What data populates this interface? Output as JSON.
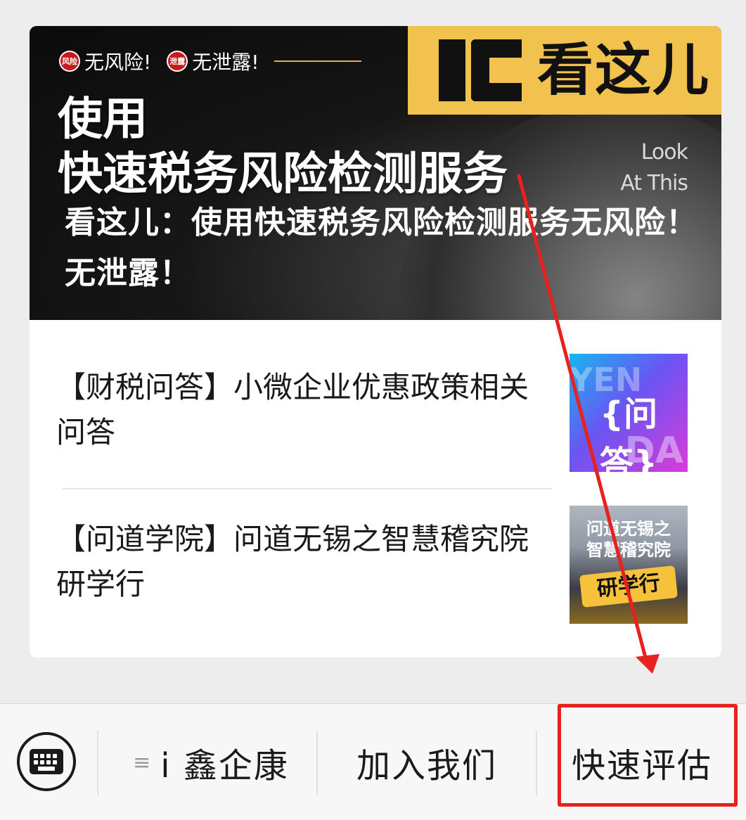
{
  "banner": {
    "tag_seal_1": "风险",
    "tag_text_1": "无风险!",
    "tag_seal_2": "泄露",
    "tag_text_2": "无泄露!",
    "logo_text": "看这儿",
    "look_line_1": "Look",
    "look_line_2": "At This",
    "headline_line_1": "使用",
    "headline_line_2": "快速税务风险检测服务",
    "subtitle": "看这儿：使用快速税务风险检测服务无风险！无泄露！"
  },
  "articles": [
    {
      "title": "【财税问答】小微企业优惠政策相关问答",
      "thumb_ghost_1": "YEN",
      "thumb_main": "{问答}",
      "thumb_ghost_2": "DA"
    },
    {
      "title": "【问道学院】问道无锡之智慧稽究院研学行",
      "thumb_line_1": "问道无锡之",
      "thumb_line_2": "智慧稽究院",
      "thumb_pill": "研学行"
    }
  ],
  "menu": {
    "keyboard_icon": "keyboard-icon",
    "hamburger_icon": "≡",
    "items": [
      {
        "label": "i 鑫企康"
      },
      {
        "label": "加入我们"
      },
      {
        "label": "快速评估"
      }
    ]
  },
  "colors": {
    "annotation_red": "#e8211d",
    "logo_yellow": "#f2c24e",
    "seal_red": "#c8191b"
  }
}
